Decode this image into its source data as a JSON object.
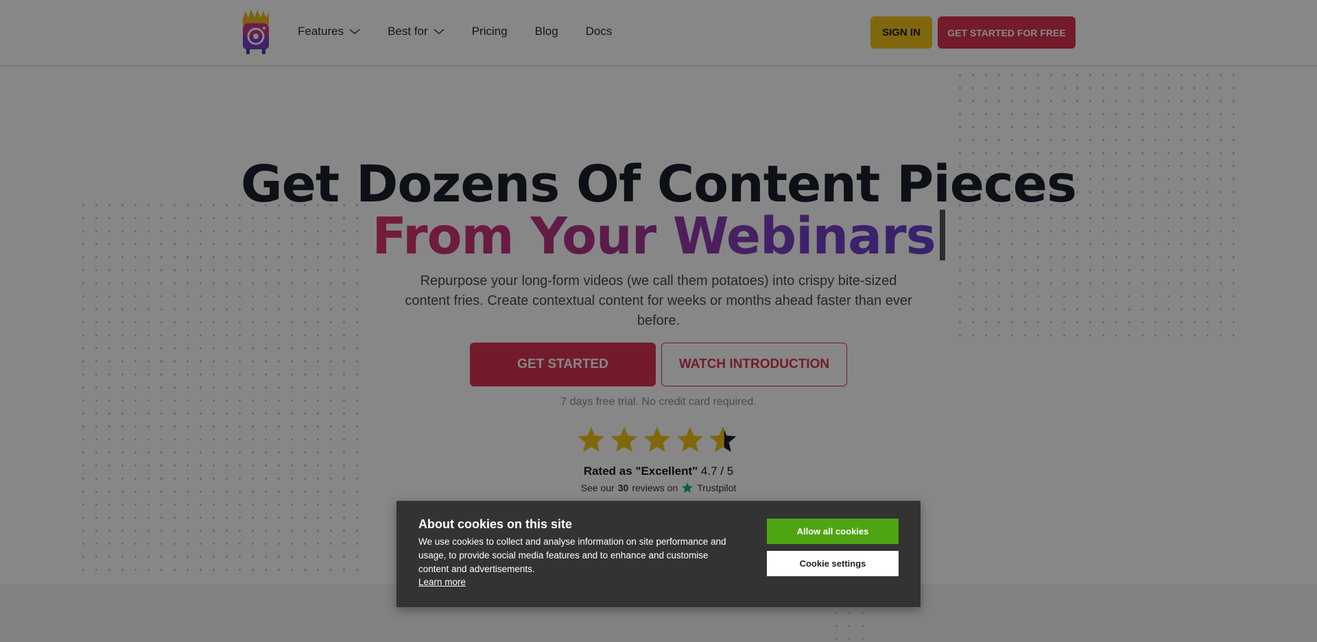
{
  "header": {
    "logo": "fries-camera-logo",
    "nav": [
      {
        "label": "Features",
        "has_dropdown": true
      },
      {
        "label": "Best for",
        "has_dropdown": true
      },
      {
        "label": "Pricing",
        "has_dropdown": false
      },
      {
        "label": "Blog",
        "has_dropdown": false
      },
      {
        "label": "Docs",
        "has_dropdown": false
      }
    ],
    "sign_in": "SIGN IN",
    "get_started_free": "GET STARTED FOR FREE"
  },
  "hero": {
    "title_line1": "Get Dozens Of Content Pieces",
    "title_line2": "From Your Webinars",
    "subtitle": "Repurpose your long-form videos (we call them potatoes) into crispy bite-sized content fries. Create contextual content for weeks or months ahead faster than ever before.",
    "cta_primary": "GET STARTED",
    "cta_secondary": "WATCH INTRODUCTION",
    "trial_note": "7 days free trial. No credit card required."
  },
  "rating": {
    "stars_value": 4.7,
    "stars_max": 5,
    "rated_prefix": "Rated as \"Excellent\"",
    "score": "4.7 / 5",
    "reviews_prefix": "See our",
    "reviews_count": "30",
    "reviews_suffix": "reviews on",
    "platform": "Trustpilot"
  },
  "cookie_banner": {
    "title": "About cookies on this site",
    "body": "We use cookies to collect and analyse information on site performance and usage, to provide social media features and to enhance and customise content and advertisements.",
    "learn_more": "Learn more",
    "allow_all": "Allow all cookies",
    "settings": "Cookie settings"
  },
  "colors": {
    "brand_red": "#d93352",
    "brand_yellow": "#f2c21b",
    "star_yellow": "#f2c21b",
    "cookie_bg": "#333333",
    "allow_green": "#4fa511",
    "trustpilot_green": "#00b67a"
  }
}
